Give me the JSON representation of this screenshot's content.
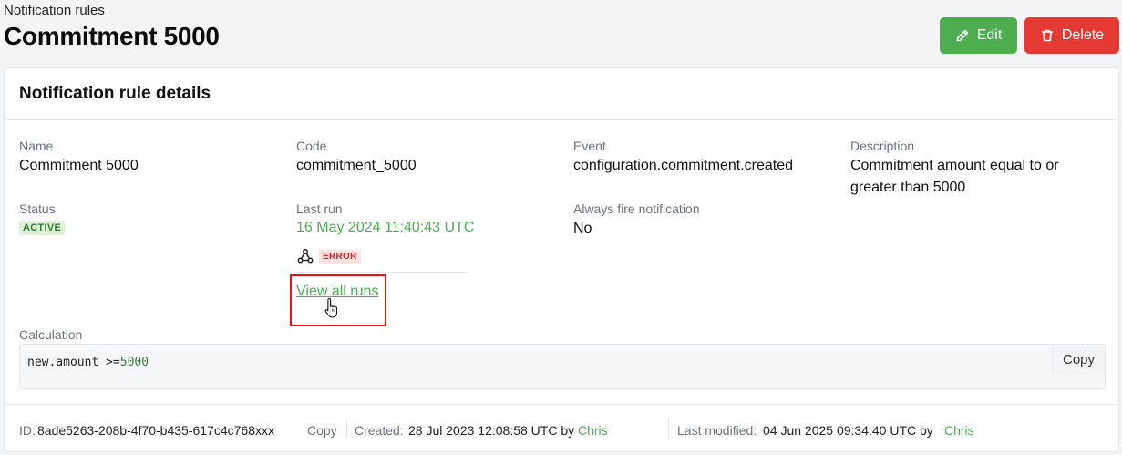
{
  "header": {
    "breadcrumb": "Notification rules",
    "title": "Commitment 5000",
    "edit_label": "Edit",
    "delete_label": "Delete"
  },
  "colors": {
    "edit": "#4cae4f",
    "delete": "#e53935",
    "accent": "#4caf50"
  },
  "card": {
    "title": "Notification rule details",
    "name_label": "Name",
    "name_value": "Commitment 5000",
    "code_label": "Code",
    "code_value": "commitment_5000",
    "event_label": "Event",
    "event_value": "configuration.commitment.created",
    "description_label": "Description",
    "description_line1": "Commitment amount equal to or",
    "description_line2": "greater than 5000",
    "status_label": "Status",
    "status_value": "ACTIVE",
    "last_run_label": "Last run",
    "last_run_date": "16 May 2024 11:40:43 UTC",
    "last_run_status": "ERROR",
    "view_all_runs": "View all runs",
    "always_fire_label": "Always fire notification",
    "always_fire_value": "No",
    "calculation_label": "Calculation",
    "calculation_expr": "new.amount >=",
    "calculation_num": "5000",
    "copy_code_label": "Copy"
  },
  "footer": {
    "id_label": "ID:",
    "id_value": "8ade5263-208b-4f70-b435-617c4c768xxx",
    "copy_label": "Copy",
    "created_label": "Created:",
    "created_value": "28 Jul 2023 12:08:58 UTC by",
    "created_by": "Chris",
    "modified_label": "Last modified:",
    "modified_value": "04 Jun 2025 09:34:40 UTC by",
    "modified_by": "Chris"
  },
  "icons": [
    "pencil-icon",
    "trash-icon",
    "webhook-icon",
    "hand-cursor-icon"
  ]
}
